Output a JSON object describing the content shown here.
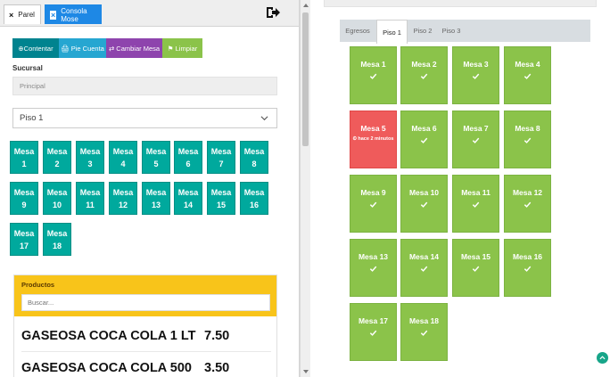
{
  "panel_tabs": [
    {
      "label": "Parel",
      "close": "×"
    },
    {
      "label": "Consola Mose",
      "close": "×"
    }
  ],
  "toolbar": {
    "contentar": "⊕Contentar",
    "pie_cuenta": "🖨 Pie Cuenta",
    "cambiar_mesa": "⇄ Cambiar Mesa",
    "limpiar": "⚑ Limpiar"
  },
  "sucursal": {
    "label": "Sucursal",
    "value": "Principal"
  },
  "piso_select": {
    "value": "Piso 1"
  },
  "left_mesas": [
    {
      "line1": "Mesa 1",
      "line2": ""
    },
    {
      "line1": "Mesa 2",
      "line2": ""
    },
    {
      "line1": "Mesa 3",
      "line2": ""
    },
    {
      "line1": "Mesa 4",
      "line2": ""
    },
    {
      "line1": "Mesa 5",
      "line2": ""
    },
    {
      "line1": "Mesa 6",
      "line2": ""
    },
    {
      "line1": "Mesa 7",
      "line2": ""
    },
    {
      "line1": "Mesa 8",
      "line2": ""
    },
    {
      "line1": "Mesa 9",
      "line2": ""
    },
    {
      "line1": "Mesa",
      "line2": "10"
    },
    {
      "line1": "Mesa",
      "line2": "11"
    },
    {
      "line1": "Mesa",
      "line2": "12"
    },
    {
      "line1": "Mesa",
      "line2": "13"
    },
    {
      "line1": "Mesa",
      "line2": "14"
    },
    {
      "line1": "Mesa",
      "line2": "15"
    },
    {
      "line1": "Mesa",
      "line2": "16"
    },
    {
      "line1": "Mesa",
      "line2": "17"
    },
    {
      "line1": "Mesa",
      "line2": "18"
    }
  ],
  "productos": {
    "title": "Productos",
    "search_placeholder": "Buscar...",
    "items": [
      {
        "name": "GASEOSA COCA COLA 1 LT",
        "price": "7.50"
      },
      {
        "name": "GASEOSA COCA COLA 500",
        "price": "3.50"
      }
    ]
  },
  "floor_tabs": [
    {
      "label": "Egresos",
      "active": false
    },
    {
      "label": "Piso 1",
      "active": true
    },
    {
      "label": "Piso 2",
      "active": false
    },
    {
      "label": "Piso 3",
      "active": false
    }
  ],
  "right_mesas": [
    {
      "name": "Mesa 1",
      "status": "free"
    },
    {
      "name": "Mesa 2",
      "status": "free"
    },
    {
      "name": "Mesa 3",
      "status": "free"
    },
    {
      "name": "Mesa 4",
      "status": "free"
    },
    {
      "name": "Mesa 5",
      "status": "occupied",
      "time": "⏲ hace 2 minutos"
    },
    {
      "name": "Mesa 6",
      "status": "free"
    },
    {
      "name": "Mesa 7",
      "status": "free"
    },
    {
      "name": "Mesa 8",
      "status": "free"
    },
    {
      "name": "Mesa 9",
      "status": "free"
    },
    {
      "name": "Mesa 10",
      "status": "free"
    },
    {
      "name": "Mesa 11",
      "status": "free"
    },
    {
      "name": "Mesa 12",
      "status": "free"
    },
    {
      "name": "Mesa 13",
      "status": "free"
    },
    {
      "name": "Mesa 14",
      "status": "free"
    },
    {
      "name": "Mesa 15",
      "status": "free"
    },
    {
      "name": "Mesa 16",
      "status": "free"
    },
    {
      "name": "Mesa 17",
      "status": "free"
    },
    {
      "name": "Mesa 18",
      "status": "free"
    }
  ],
  "icons": {
    "exit": "sign-out-icon",
    "check": "check-icon",
    "chevron": "chevron-down-icon",
    "fab": "chevron-up-icon"
  },
  "colors": {
    "teal_table": "#00a99d",
    "free_table": "#8bc34a",
    "occupied_table": "#ef5b5b",
    "products_header": "#f8c41a",
    "active_tab": "#1e88e5"
  }
}
